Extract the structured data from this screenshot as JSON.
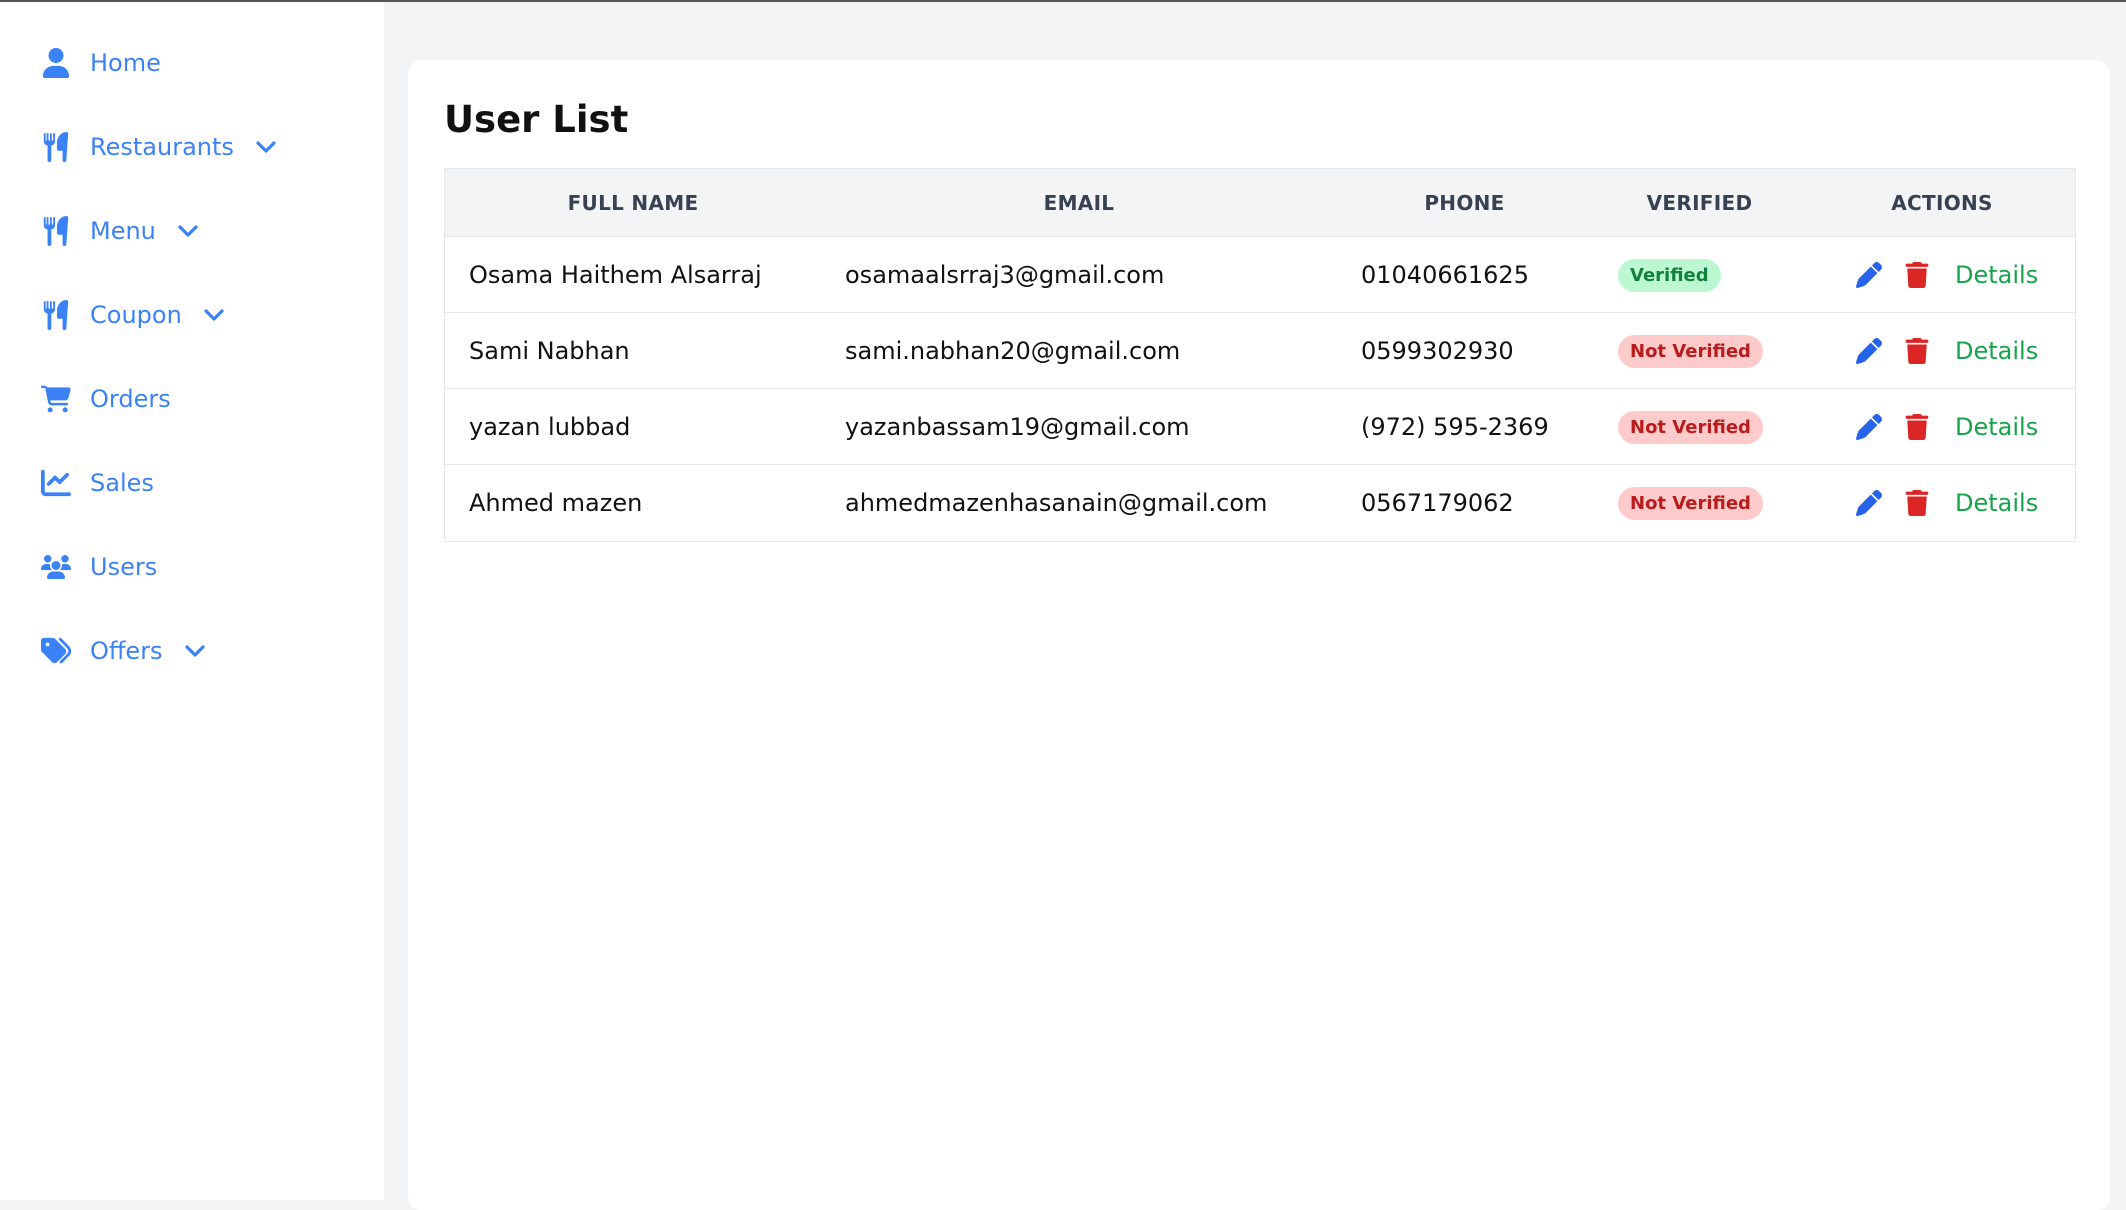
{
  "sidebar": {
    "items": [
      {
        "label": "Home",
        "icon": "user-icon",
        "has_dropdown": false
      },
      {
        "label": "Restaurants",
        "icon": "utensils-icon",
        "has_dropdown": true
      },
      {
        "label": "Menu",
        "icon": "utensils-icon",
        "has_dropdown": true
      },
      {
        "label": "Coupon",
        "icon": "utensils-icon",
        "has_dropdown": true
      },
      {
        "label": "Orders",
        "icon": "cart-icon",
        "has_dropdown": false
      },
      {
        "label": "Sales",
        "icon": "chart-line-icon",
        "has_dropdown": false
      },
      {
        "label": "Users",
        "icon": "users-icon",
        "has_dropdown": false
      },
      {
        "label": "Offers",
        "icon": "tags-icon",
        "has_dropdown": true
      }
    ]
  },
  "main": {
    "title": "User List",
    "table": {
      "headers": [
        "FULL NAME",
        "EMAIL",
        "PHONE",
        "VERIFIED",
        "ACTIONS"
      ],
      "rows": [
        {
          "name": "Osama Haithem Alsarraj",
          "email": "osamaalsrraj3@gmail.com",
          "phone": "01040661625",
          "verified": "Verified",
          "details": "Details"
        },
        {
          "name": "Sami Nabhan",
          "email": "sami.nabhan20@gmail.com",
          "phone": "0599302930",
          "verified": "Not Verified",
          "details": "Details"
        },
        {
          "name": "yazan lubbad",
          "email": "yazanbassam19@gmail.com",
          "phone": "(972) 595-2369",
          "verified": "Not Verified",
          "details": "Details"
        },
        {
          "name": "Ahmed mazen",
          "email": "ahmedmazenhasanain@gmail.com",
          "phone": "0567179062",
          "verified": "Not Verified",
          "details": "Details"
        }
      ]
    }
  },
  "colors": {
    "accent": "#3b82f6",
    "verified_bg": "#bbf7d0",
    "verified_text": "#15803d",
    "not_verified_bg": "#fecaca",
    "not_verified_text": "#b91c1c",
    "edit": "#2563eb",
    "delete": "#dc2626",
    "details": "#16a34a"
  }
}
